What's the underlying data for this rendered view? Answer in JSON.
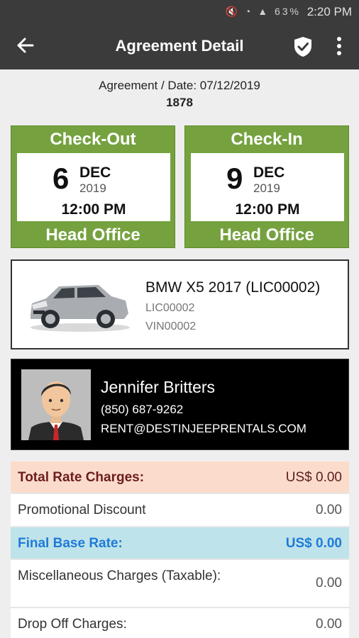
{
  "status_bar": {
    "icons": "🔇 ◔ ▲ 63%",
    "time": "2:20 PM"
  },
  "app_bar": {
    "title": "Agreement Detail"
  },
  "agreement": {
    "label": "Agreement / Date: 07/12/2019",
    "number": "1878"
  },
  "checkout": {
    "heading": "Check-Out",
    "day": "6",
    "month": "DEC",
    "year": "2019",
    "time": "12:00 PM",
    "location": "Head Office"
  },
  "checkin": {
    "heading": "Check-In",
    "day": "9",
    "month": "DEC",
    "year": "2019",
    "time": "12:00 PM",
    "location": "Head Office"
  },
  "vehicle": {
    "name": "BMW X5 2017 (LIC00002)",
    "license": "LIC00002",
    "vin": "VIN00002"
  },
  "customer": {
    "name": "Jennifer Britters",
    "phone": "(850) 687-9262",
    "email": "RENT@DESTINJEEPRENTALS.COM"
  },
  "charges": {
    "total_rate": {
      "label": "Total Rate Charges:",
      "value": "US$ 0.00"
    },
    "promo": {
      "label": "Promotional Discount",
      "value": "0.00"
    },
    "final_base": {
      "label": "Final Base Rate:",
      "value": "US$ 0.00"
    },
    "misc": {
      "label": "Miscellaneous Charges (Taxable):",
      "value": "0.00"
    },
    "dropoff": {
      "label": "Drop Off Charges:",
      "value": "0.00"
    }
  },
  "colors": {
    "green": "#75a23f",
    "appbar": "#3b3b3b",
    "total_bg": "#fbdccb",
    "final_bg": "#bfe3ea",
    "final_text": "#1e7bd8"
  }
}
